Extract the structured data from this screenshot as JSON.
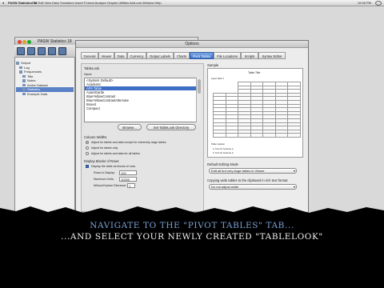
{
  "menubar": {
    "app": "PASW Statistics 18",
    "menus": "File  Edit  View  Data  Transform  Insert  Format  Analyze  Graphs  Utilities  Add-ons  Window  Help",
    "clock": "10:05 PM"
  },
  "app_window": {
    "title": "PASW Statistics 18",
    "tree": [
      {
        "label": "Output",
        "selected": false
      },
      {
        "label": "Log",
        "selected": false
      },
      {
        "label": "Frequencies",
        "selected": false
      },
      {
        "label": "Title",
        "selected": false
      },
      {
        "label": "Notes",
        "selected": false
      },
      {
        "label": "Active Dataset",
        "selected": false
      },
      {
        "label": "Statistics",
        "selected": true
      },
      {
        "label": "Example Data",
        "selected": false
      }
    ]
  },
  "dialog": {
    "title": "Options",
    "tabs": [
      {
        "label": "General",
        "active": false
      },
      {
        "label": "Viewer",
        "active": false
      },
      {
        "label": "Data",
        "active": false
      },
      {
        "label": "Currency",
        "active": false
      },
      {
        "label": "Output Labels",
        "active": false
      },
      {
        "label": "Charts",
        "active": false
      },
      {
        "label": "Pivot Tables",
        "active": true
      },
      {
        "label": "File Locations",
        "active": false
      },
      {
        "label": "Scripts",
        "active": false
      },
      {
        "label": "Syntax Editor",
        "active": false
      }
    ],
    "tablelook": {
      "heading": "TableLook",
      "name_label": "Name",
      "items": [
        {
          "label": "<System Default>",
          "selected": false
        },
        {
          "label": "Academic",
          "selected": false
        },
        {
          "label": "APA Table",
          "selected": true
        },
        {
          "label": "AvantGarde",
          "selected": false
        },
        {
          "label": "BlueYellowContrast",
          "selected": false
        },
        {
          "label": "BlueYellowContrastAlternate",
          "selected": false
        },
        {
          "label": "Boxed",
          "selected": false
        },
        {
          "label": "Compact",
          "selected": false
        }
      ],
      "browse_button": "Browse...",
      "set_dir_button": "Set TableLook Directory"
    },
    "column_widths": {
      "heading": "Column Widths",
      "options": [
        {
          "label": "Adjust for labels and data except for extremely large tables",
          "checked": true
        },
        {
          "label": "Adjust for labels only",
          "checked": false
        },
        {
          "label": "Adjust for labels and data for all tables",
          "checked": false
        }
      ]
    },
    "blocks": {
      "heading": "Display Blocks of Rows",
      "checkbox_label": "Display the table as blocks of rows",
      "rows_to_display_label": "Rows to Display:",
      "rows_to_display_value": "100",
      "max_cells_label": "Maximum Cells:",
      "max_cells_value": "10000",
      "widow_label": "Widow/Orphan Tolerance:",
      "widow_value": "1"
    },
    "sample": {
      "heading": "Sample",
      "table_title": "Table Title",
      "layer_label": "Layer label 1",
      "footnote1": "a. Text for footnote a",
      "footnote2": "b. Text for footnote b",
      "caption": "Table Caption"
    },
    "editing_mode": {
      "heading": "Default Editing Mode",
      "value": "Edit all but very large tables in Viewer"
    },
    "copy_wide": {
      "heading": "Copying wide tables to the clipboard in rich text format",
      "value": "Do not adjust width"
    }
  },
  "subtitle": {
    "line1": "NAVIGATE TO THE \"PIVOT TABLES\" TAB...",
    "line2": "...AND SELECT YOUR NEWLY CREATED \"TABLELOOK\""
  },
  "colors": {
    "subtitle_line1": "#7aa2d6",
    "subtitle_line2": "#f2f2f2",
    "active_tab": "#3b72c7",
    "selection": "#3f6fc5"
  }
}
